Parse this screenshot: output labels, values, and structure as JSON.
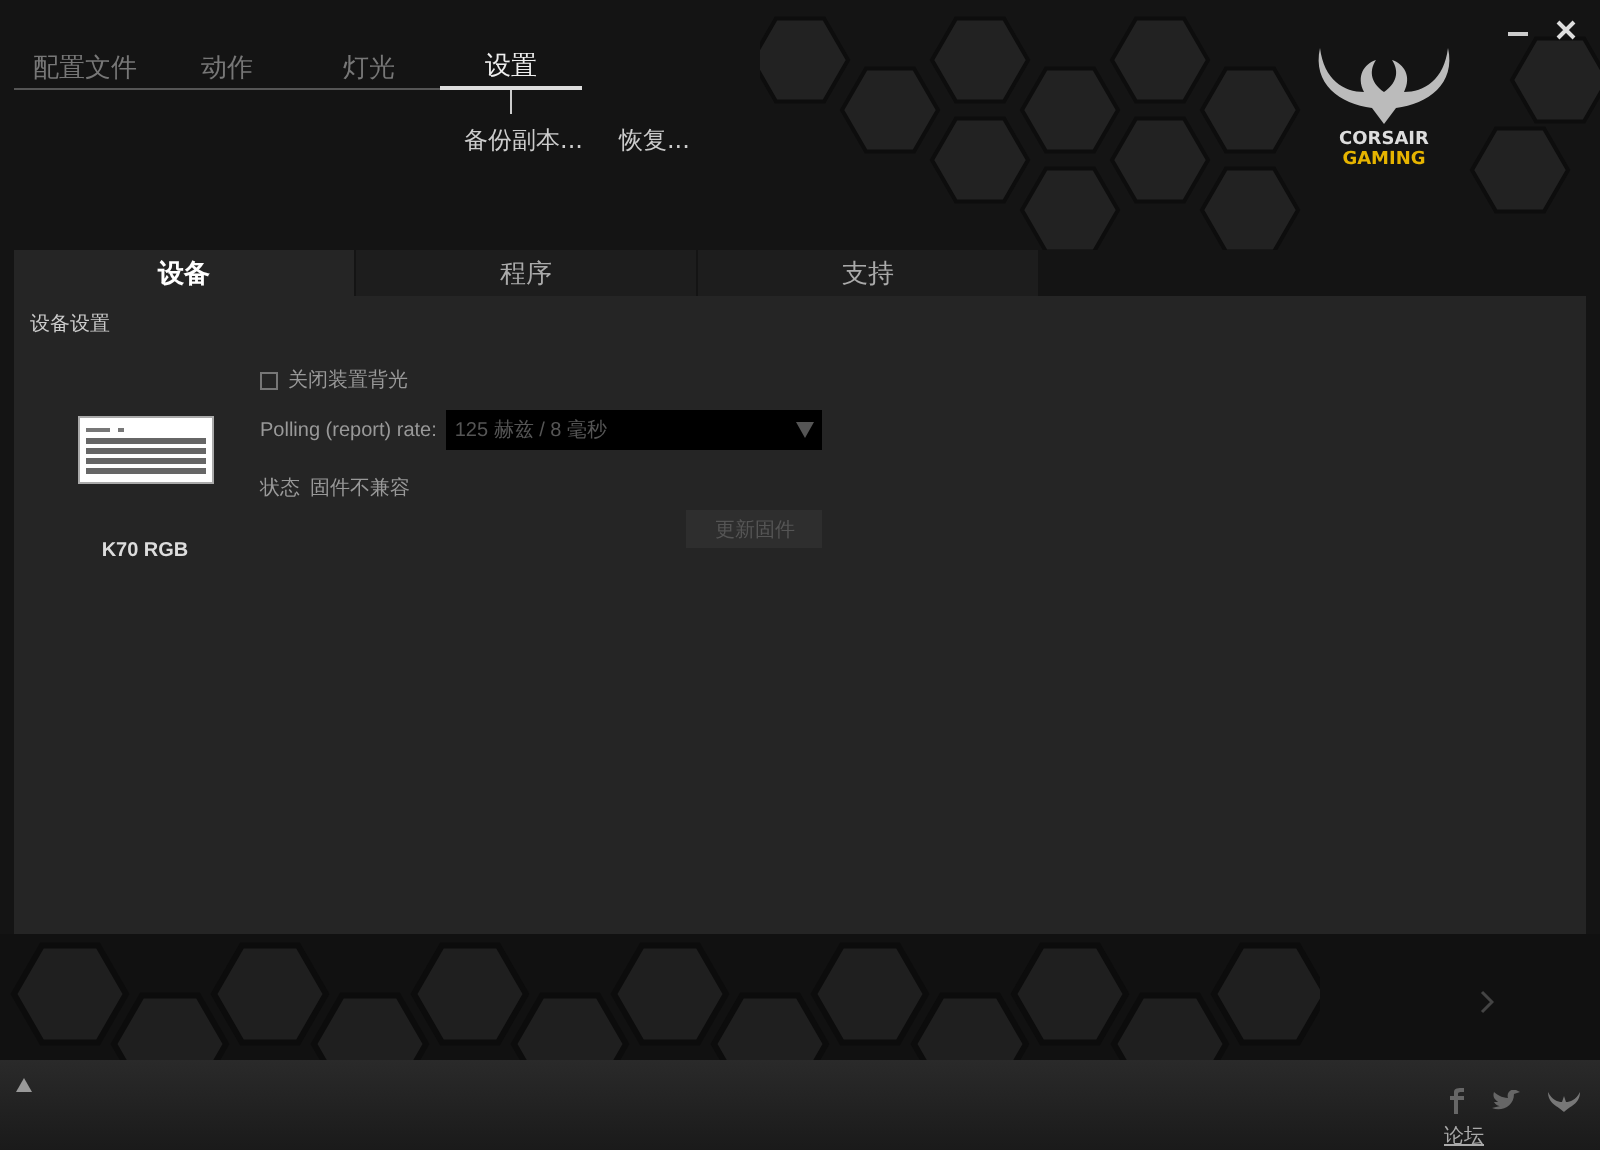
{
  "main_tabs": [
    {
      "label": "配置文件",
      "selected": false
    },
    {
      "label": "动作",
      "selected": false
    },
    {
      "label": "灯光",
      "selected": false
    },
    {
      "label": "设置",
      "selected": true
    }
  ],
  "actions": [
    "备份副本...",
    "恢复..."
  ],
  "logo": {
    "line1": "CORSAIR",
    "line2": "GAMING"
  },
  "sub_tabs": [
    {
      "label": "设备",
      "selected": true
    },
    {
      "label": "程序",
      "selected": false
    },
    {
      "label": "支持",
      "selected": false
    }
  ],
  "section_title": "设备设置",
  "device": {
    "name": "K70 RGB"
  },
  "backlight_off": {
    "label": "关闭装置背光",
    "checked": false
  },
  "polling": {
    "label": "Polling (report) rate:",
    "value": "125 赫兹 / 8 毫秒"
  },
  "status": {
    "label": "状态",
    "value": "固件不兼容"
  },
  "update_button": {
    "label": "更新固件",
    "disabled": true
  },
  "footer": {
    "link": "论坛"
  }
}
